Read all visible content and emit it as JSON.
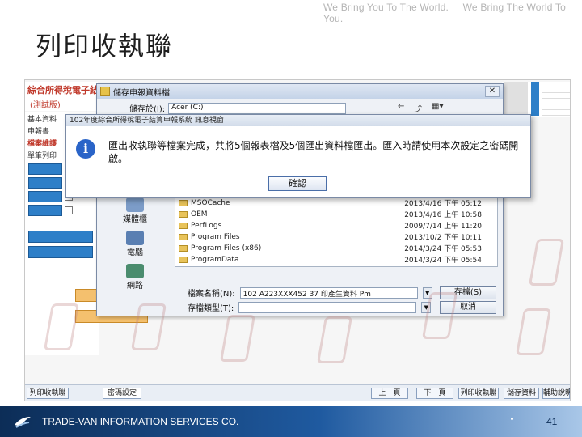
{
  "slogan": [
    "We Bring You To The World.",
    "We Bring The World To You."
  ],
  "slide_title": "列印收執聯",
  "app": {
    "title": "綜合所得稅電子結算申報",
    "subtitle": "(測試版)",
    "left_lines": [
      "基本資料",
      "申報書"
    ],
    "section_label": "檔案維護",
    "section_sub": "單筆列印",
    "btn_label": "列印"
  },
  "save_dialog": {
    "title": "儲存申報資料檔",
    "location_label": "儲存於(I):",
    "location_value": "Acer (C:)",
    "places": [
      {
        "label": "媒體櫃",
        "icon": "library-icon"
      },
      {
        "label": "電腦",
        "icon": "computer-icon"
      },
      {
        "label": "網路",
        "icon": "network-icon"
      }
    ],
    "files": [
      {
        "name": "MSOCache",
        "date": "2013/4/16 下午 05:12"
      },
      {
        "name": "OEM",
        "date": "2013/4/16 上午 10:58"
      },
      {
        "name": "PerfLogs",
        "date": "2009/7/14 上午 11:20"
      },
      {
        "name": "Program Files",
        "date": "2013/10/2 下午 10:11"
      },
      {
        "name": "Program Files (x86)",
        "date": "2014/3/24 下午 05:53"
      },
      {
        "name": "ProgramData",
        "date": "2014/3/24 下午 05:54"
      }
    ],
    "filename_label": "檔案名稱(N):",
    "filename_value": "102 A223XXX452 37 印產生資料 Pm",
    "filetype_label": "存檔類型(T):",
    "save_button": "存檔(S)",
    "cancel_button": "取消"
  },
  "alert": {
    "title": "102年度綜合所得稅電子結算申報系統 訊息視窗",
    "message": "匯出收執聯等檔案完成，共將5個報表檔及5個匯出資料檔匯出。匯入時請使用本次設定之密碼開啟。",
    "ok_button": "確認"
  },
  "bottom_bar": {
    "left_label": "列印收執聯",
    "settings_button": "密碼設定",
    "prev_button": "上一頁",
    "next_button": "下一頁",
    "report_button": "列印收執聯",
    "save_button": "儲存資料",
    "help_button": "輔助說明"
  },
  "footer": {
    "company": "TRADE-VAN INFORMATION SERVICES CO.",
    "page_number": "41"
  }
}
